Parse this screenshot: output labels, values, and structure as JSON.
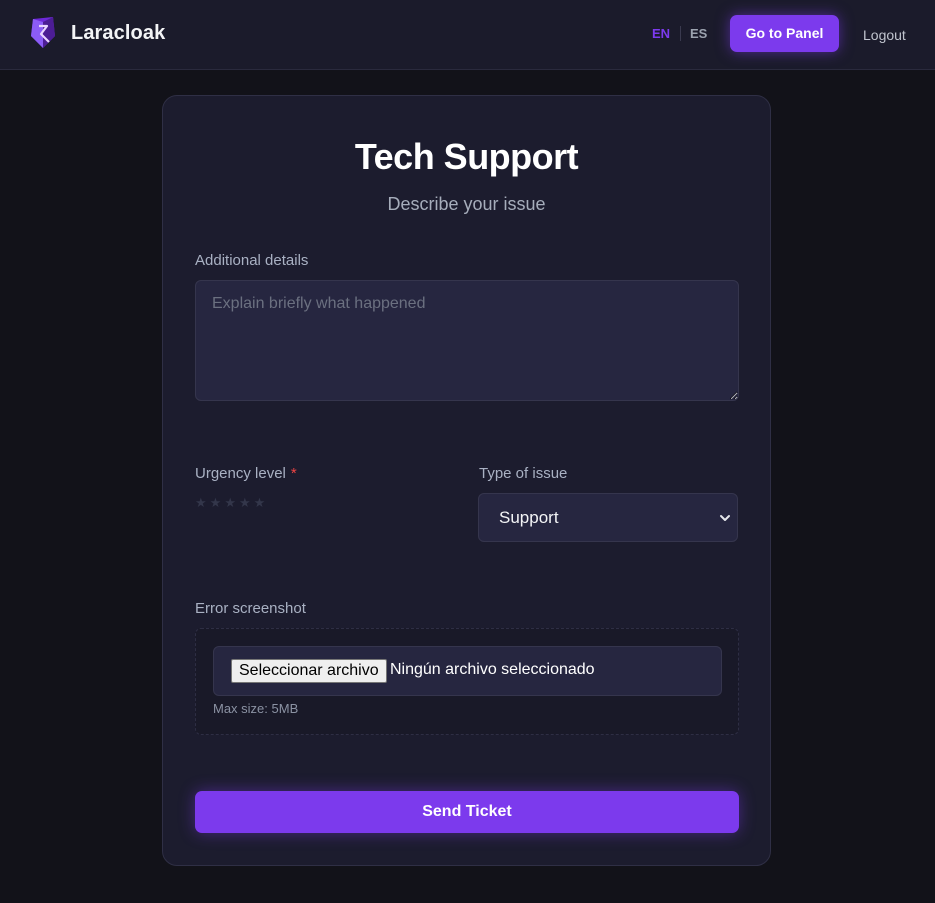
{
  "header": {
    "brand_name": "Laracloak",
    "languages": {
      "en": "EN",
      "es": "ES",
      "active": "EN"
    },
    "panel_button": "Go to Panel",
    "logout": "Logout"
  },
  "form": {
    "title": "Tech Support",
    "subtitle": "Describe your issue",
    "details": {
      "label": "Additional details",
      "placeholder": "Explain briefly what happened",
      "value": ""
    },
    "urgency": {
      "label": "Urgency level",
      "required_mark": "*",
      "stars": [
        "★",
        "★",
        "★",
        "★",
        "★"
      ],
      "rating": 0
    },
    "issue_type": {
      "label": "Type of issue",
      "selected": "Support"
    },
    "screenshot": {
      "label": "Error screenshot",
      "file_button": "Seleccionar archivo",
      "file_status": "Ningún archivo seleccionado",
      "hint": "Max size: 5MB"
    },
    "submit": "Send Ticket"
  },
  "colors": {
    "accent": "#7c3aed",
    "background": "#121219",
    "header": "#1b1b2b",
    "card": "#1c1c2e",
    "required": "#ef4444"
  },
  "icons": [
    "laracloak-logo-icon",
    "chevron-down-icon"
  ]
}
